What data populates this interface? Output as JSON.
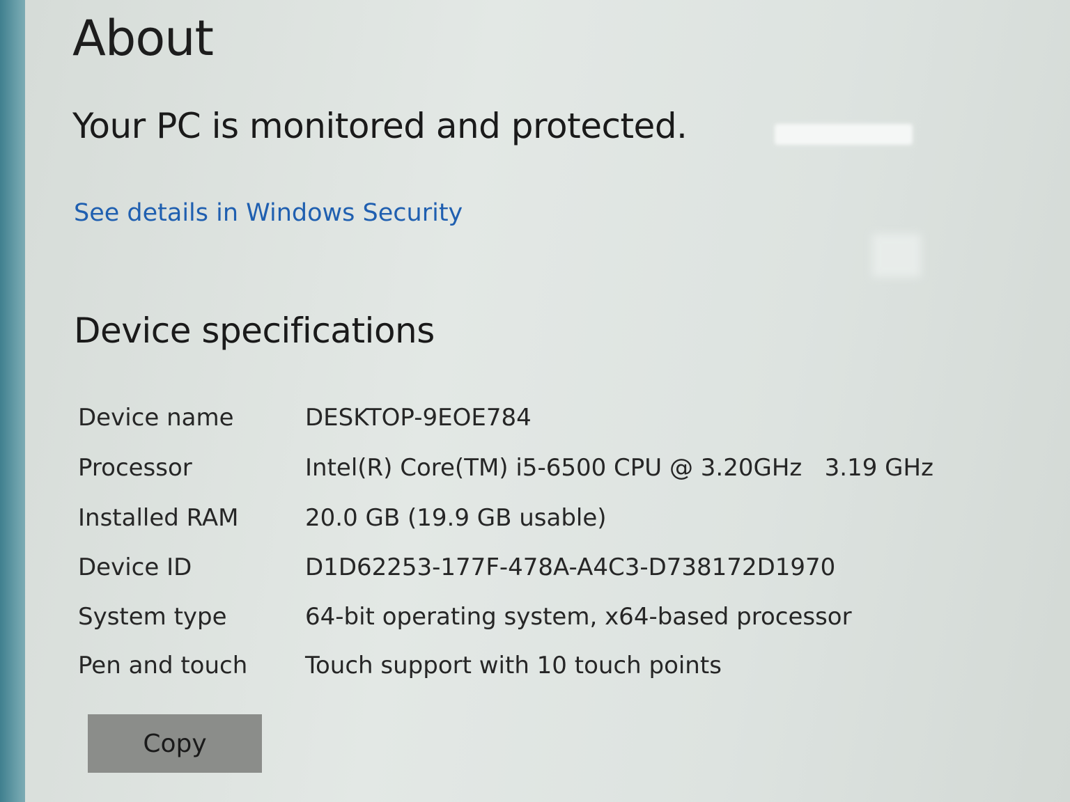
{
  "page": {
    "title": "About"
  },
  "security": {
    "status": "Your PC is monitored and protected.",
    "details_link": "See details in Windows Security"
  },
  "specs": {
    "heading": "Device specifications",
    "rows": [
      {
        "label": "Device name",
        "value": "DESKTOP-9EOE784"
      },
      {
        "label": "Processor",
        "value": "Intel(R) Core(TM) i5-6500 CPU @ 3.20GHz   3.19 GHz"
      },
      {
        "label": "Installed RAM",
        "value": "20.0 GB (19.9 GB usable)"
      },
      {
        "label": "Device ID",
        "value": "D1D62253-177F-478A-A4C3-D738172D1970"
      },
      {
        "label": "System type",
        "value": "64-bit operating system, x64-based processor"
      },
      {
        "label": "Pen and touch",
        "value": "Touch support with 10 touch points"
      }
    ],
    "copy_label": "Copy"
  },
  "colors": {
    "link": "#1f5fb0",
    "button": "#8b8d8a",
    "text": "#1a1a1a"
  }
}
